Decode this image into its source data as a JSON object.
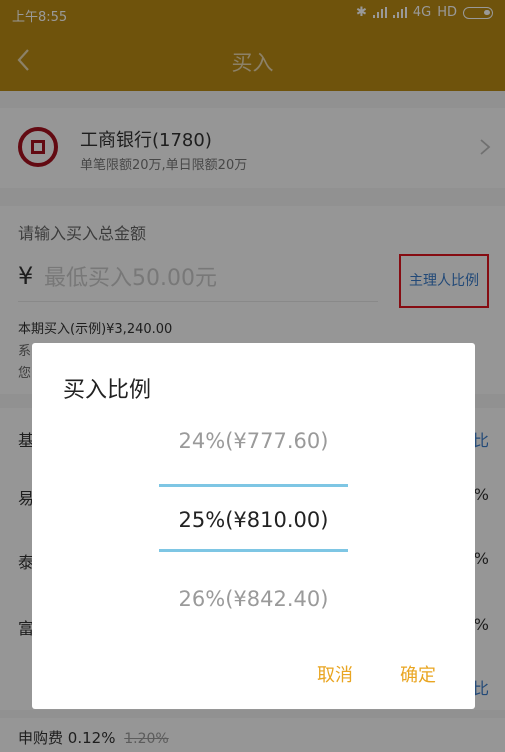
{
  "status_bar": {
    "time": "上午8:55",
    "network": "4G",
    "hd": "HD"
  },
  "header": {
    "title": "买入"
  },
  "bank": {
    "name": "工商银行(1780)",
    "limit": "单笔限额20万,单日限额20万"
  },
  "amount": {
    "prompt": "请输入买入总金额",
    "currency": "¥",
    "placeholder": "最低买入50.00元",
    "ratio_link": "主理人比例",
    "period_line": "本期买入(示例)¥3,240.00",
    "note1": "系",
    "note2": "您"
  },
  "fund_rows": [
    {
      "label": "基",
      "right": "比"
    },
    {
      "label": "易",
      "right": "%"
    },
    {
      "label": "泰",
      "right": "%"
    },
    {
      "label": "富",
      "right": "%"
    },
    {
      "label": "",
      "right": "比"
    }
  ],
  "fee": {
    "label": "申购费",
    "rate": "0.12%",
    "original": "1.20%"
  },
  "dialog": {
    "title": "买入比例",
    "options": [
      "24%(¥777.60)",
      "25%(¥810.00)",
      "26%(¥842.40)"
    ],
    "selected_index": 1,
    "cancel": "取消",
    "confirm": "确定"
  },
  "colors": {
    "brand_bar": "#b98a14",
    "accent_button": "#e9a521",
    "link": "#3a7bc8",
    "picker_line": "#7ec6e4",
    "highlight_box": "#e0141e"
  }
}
